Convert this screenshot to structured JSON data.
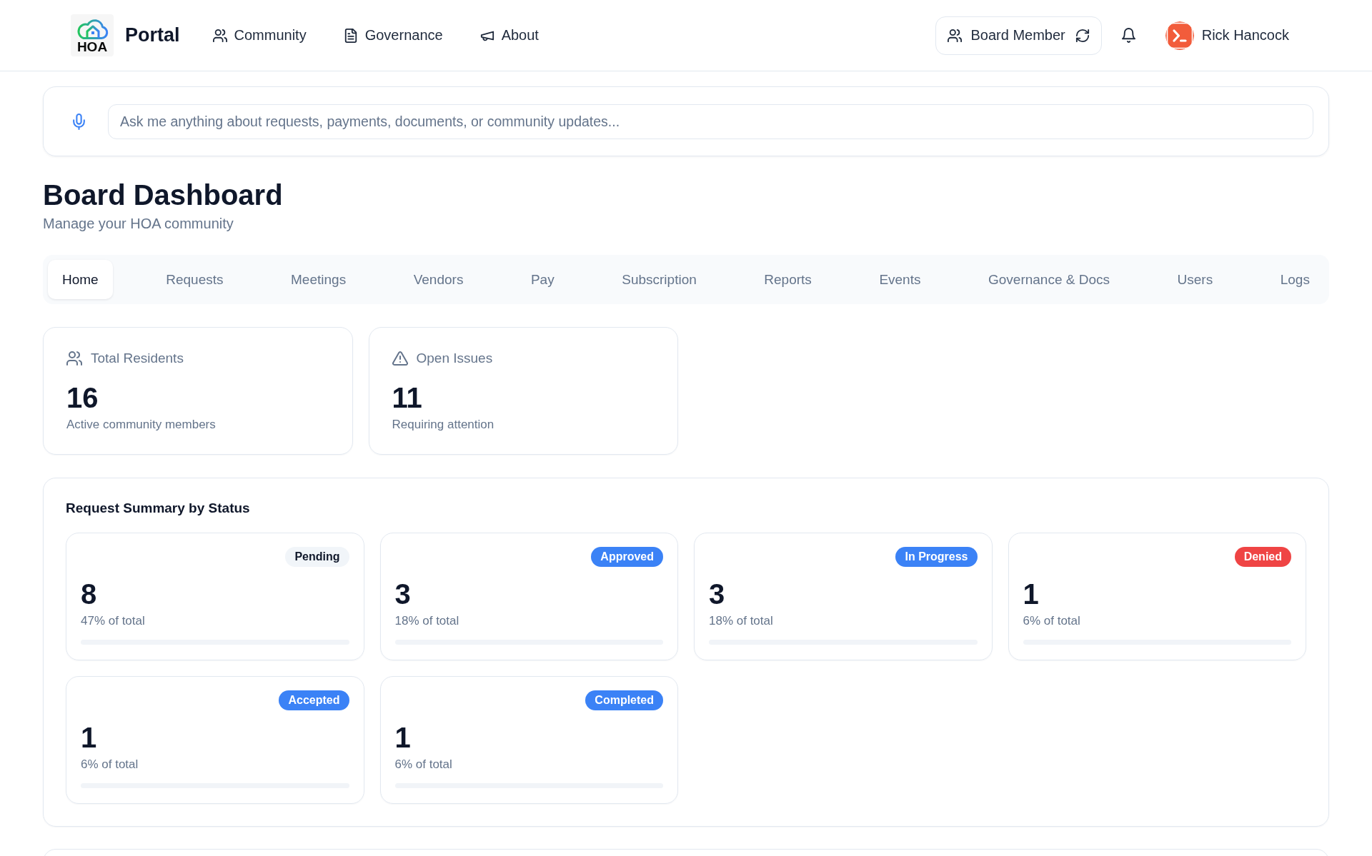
{
  "header": {
    "logo_text": "HOA",
    "brand": "Portal",
    "nav": [
      {
        "label": "Community"
      },
      {
        "label": "Governance"
      },
      {
        "label": "About"
      }
    ],
    "role_button": {
      "label": "Board Member"
    },
    "user": {
      "name": "Rick Hancock"
    }
  },
  "assistant": {
    "placeholder": "Ask me anything about requests, payments, documents, or community updates..."
  },
  "page": {
    "title": "Board Dashboard",
    "subtitle": "Manage your HOA community"
  },
  "tabs": [
    {
      "label": "Home",
      "selected": true
    },
    {
      "label": "Requests",
      "selected": false
    },
    {
      "label": "Meetings",
      "selected": false
    },
    {
      "label": "Vendors",
      "selected": false
    },
    {
      "label": "Pay",
      "selected": false
    },
    {
      "label": "Subscription",
      "selected": false
    },
    {
      "label": "Reports",
      "selected": false
    },
    {
      "label": "Events",
      "selected": false
    },
    {
      "label": "Governance & Docs",
      "selected": false
    },
    {
      "label": "Users",
      "selected": false
    },
    {
      "label": "Logs",
      "selected": false
    }
  ],
  "stats": [
    {
      "label": "Total Residents",
      "value": "16",
      "caption": "Active community members"
    },
    {
      "label": "Open Issues",
      "value": "11",
      "caption": "Requiring attention"
    }
  ],
  "request_summary": {
    "title": "Request Summary by Status",
    "statuses": [
      {
        "status": "Pending",
        "color": "#f1f5f9",
        "count": "8",
        "share": "47% of total"
      },
      {
        "status": "Approved",
        "color": "#3b82f6",
        "count": "3",
        "share": "18% of total"
      },
      {
        "status": "In Progress",
        "color": "#3b82f6",
        "count": "3",
        "share": "18% of total"
      },
      {
        "status": "Denied",
        "color": "#ef4444",
        "count": "1",
        "share": "6% of total"
      },
      {
        "status": "Accepted",
        "color": "#3b82f6",
        "count": "1",
        "share": "6% of total"
      },
      {
        "status": "Completed",
        "color": "#3b82f6",
        "count": "1",
        "share": "6% of total"
      }
    ]
  }
}
